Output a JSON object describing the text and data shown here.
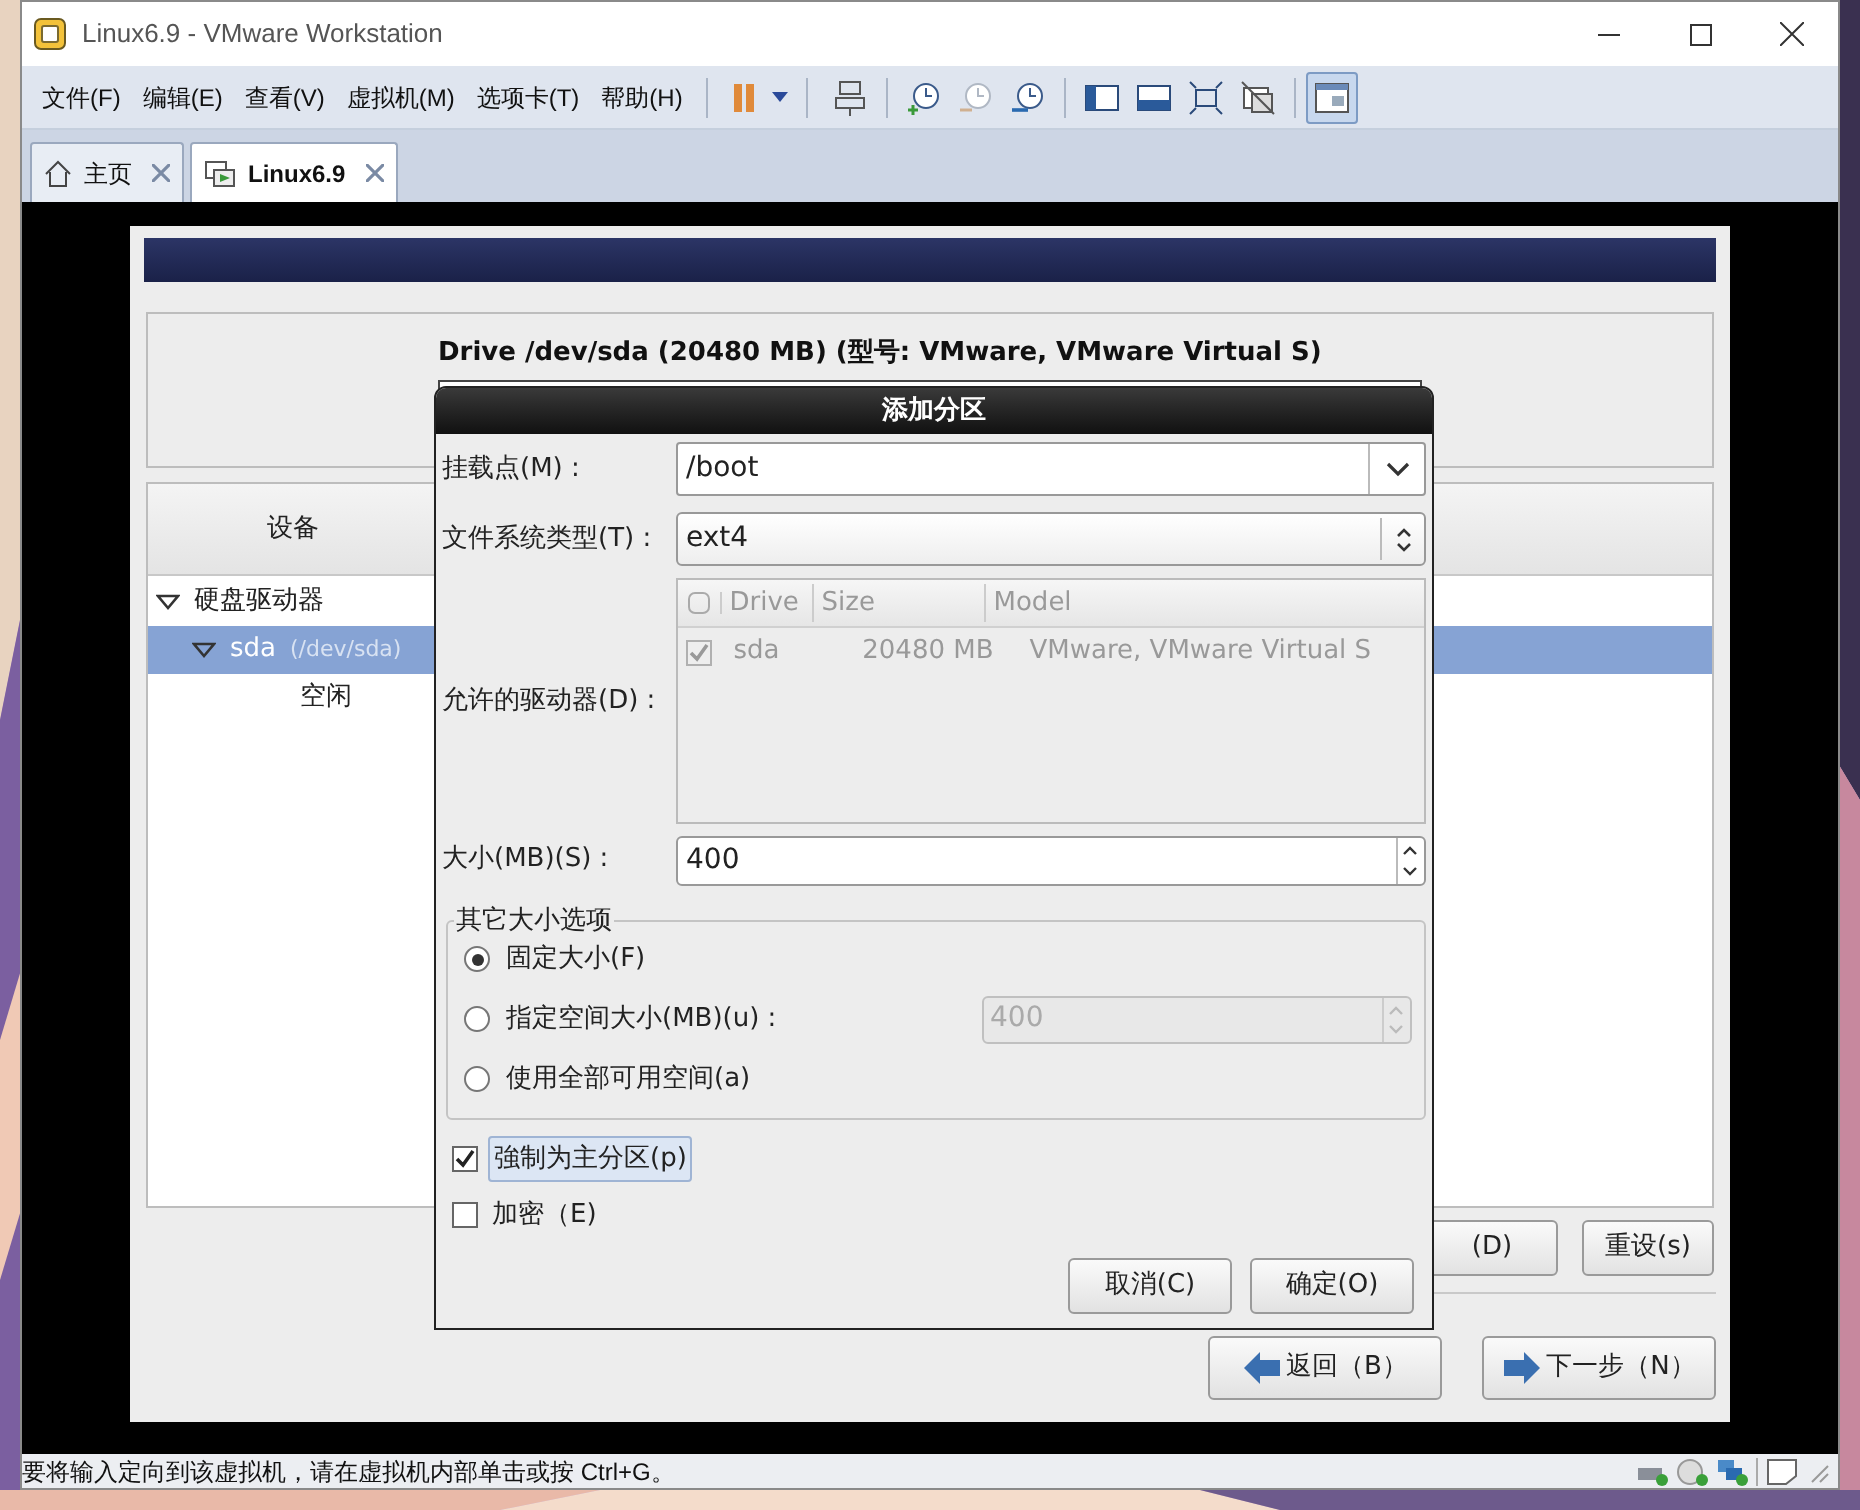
{
  "window": {
    "title": "Linux6.9 - VMware Workstation"
  },
  "menu": [
    "文件(F)",
    "编辑(E)",
    "查看(V)",
    "虚拟机(M)",
    "选项卡(T)",
    "帮助(H)"
  ],
  "tabs": [
    {
      "label": "主页",
      "selected": false
    },
    {
      "label": "Linux6.9",
      "selected": true
    }
  ],
  "installer": {
    "drive_title": "Drive /dev/sda (20480 MB) (型号: VMware, VMware Virtual S)",
    "device_column": "设备",
    "tree": [
      {
        "label": "硬盘驱动器",
        "expanded": true,
        "selected": false,
        "children": [
          {
            "label": "sda",
            "path": "(/dev/sda)",
            "expanded": true,
            "selected": true,
            "children": [
              {
                "label": "空闲",
                "selected": false
              }
            ]
          }
        ]
      }
    ],
    "buttons": [
      "(D)",
      "重设(s)"
    ],
    "nav": [
      {
        "label": "返回（B）",
        "kind": "back"
      },
      {
        "label": "下一步（N）",
        "kind": "next"
      }
    ]
  },
  "dialog": {
    "title": "添加分区",
    "mount_label": "挂载点(M) :",
    "mount_value": "/boot",
    "fs_label": "文件系统类型(T) :",
    "fs_value": "ext4",
    "drives_label": "允许的驱动器(D) :",
    "drive_columns": [
      "Drive",
      "Size",
      "Model"
    ],
    "drives": [
      {
        "drive": "sda",
        "size": "20480 MB",
        "model": "VMware, VMware Virtual S",
        "checked": true
      }
    ],
    "size_label": "大小(MB)(S) :",
    "size_value": "400",
    "options_title": "其它大小选项",
    "size_options": [
      {
        "label": "固定大小(F)",
        "selected": true
      },
      {
        "label": "指定空间大小(MB)(u) :",
        "selected": false,
        "value": "400"
      },
      {
        "label": "使用全部可用空间(a)",
        "selected": false
      }
    ],
    "checks": [
      {
        "label": "強制为主分区(p)",
        "checked": true
      },
      {
        "label": "加密（E)",
        "checked": false
      }
    ],
    "buttons": [
      "取消(C)",
      "确定(O)"
    ]
  },
  "status_bar": {
    "text": "要将输入定向到该虚拟机，请在虚拟机内部单击或按 Ctrl+G。"
  }
}
